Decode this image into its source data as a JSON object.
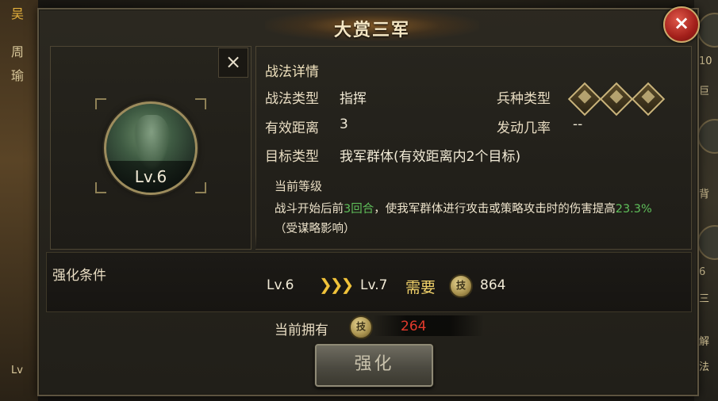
{
  "background": {
    "left_texts": [
      "吴",
      "周",
      "瑜",
      "Lv"
    ],
    "right_texts": [
      "10",
      "巨",
      "背",
      "6",
      "三",
      "解",
      "法"
    ]
  },
  "dialog": {
    "title": "大赏三军",
    "close_label": "×"
  },
  "skill_card": {
    "close_label": "×",
    "level_label": "Lv.6"
  },
  "details": {
    "header": "战法详情",
    "rows": [
      {
        "label": "战法类型",
        "value": "指挥"
      },
      {
        "label": "有效距离",
        "value": "3"
      },
      {
        "label": "目标类型",
        "value": "我军群体(有效距离内2个目标)"
      }
    ],
    "troop_type_label": "兵种类型",
    "troop_icons": [
      "cavalry-icon",
      "shield-icon",
      "archer-icon"
    ],
    "trigger_label": "发动几率",
    "trigger_value": "--",
    "current_level_label": "当前等级",
    "desc_part1": "战斗开始后前",
    "desc_rounds": "3回合",
    "desc_part2": "，使我军群体进行攻击或策略攻击时的伤害提高",
    "desc_percent": "23.3%",
    "desc_part3": "（受谋略影响）"
  },
  "enhance": {
    "label": "强化条件",
    "from_level": "Lv.6",
    "to_level": "Lv.7",
    "need_label": "需要",
    "need_amount": "864",
    "owned_label": "当前拥有",
    "owned_amount": "264",
    "button_label": "强化",
    "coin_icon": "skill-point-icon"
  },
  "colors": {
    "highlight_green": "#5fbf5a",
    "insufficient_red": "#e23a2c",
    "arrow_yellow": "#f0c23a"
  }
}
